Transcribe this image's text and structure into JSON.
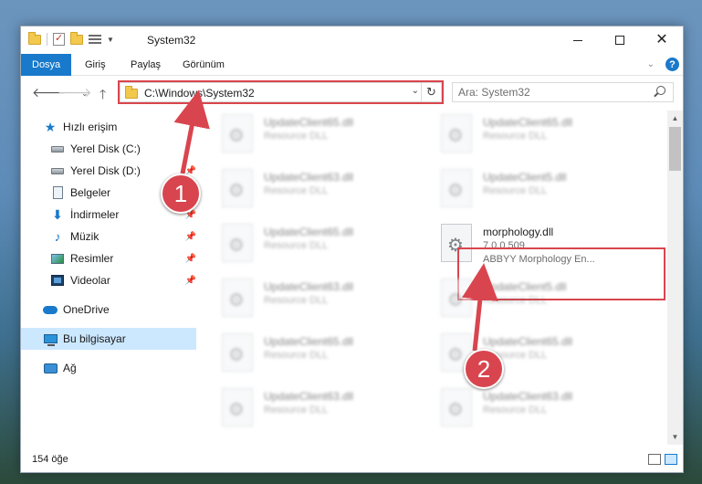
{
  "window": {
    "title": "System32"
  },
  "ribbon": {
    "tabs": [
      "Dosya",
      "Giriş",
      "Paylaş",
      "Görünüm"
    ],
    "help_label": "?"
  },
  "nav": {
    "back_icon": "arrow-left-icon",
    "forward_icon": "arrow-right-icon",
    "recent_icon": "chevron-down-icon",
    "up_icon": "arrow-up-icon"
  },
  "address": {
    "path": "C:\\Windows\\System32"
  },
  "search": {
    "placeholder": "Ara: System32"
  },
  "sidebar": {
    "items": [
      {
        "label": "Hızlı erişim",
        "icon": "star-icon"
      },
      {
        "label": "Yerel Disk (C:)",
        "icon": "drive-icon"
      },
      {
        "label": "Yerel Disk (D:)",
        "icon": "drive-icon"
      },
      {
        "label": "Belgeler",
        "icon": "documents-icon"
      },
      {
        "label": "İndirmeler",
        "icon": "download-icon"
      },
      {
        "label": "Müzik",
        "icon": "music-icon"
      },
      {
        "label": "Resimler",
        "icon": "pictures-icon"
      },
      {
        "label": "Videolar",
        "icon": "videos-icon"
      },
      {
        "label": "OneDrive",
        "icon": "cloud-icon"
      },
      {
        "label": "Bu bilgisayar",
        "icon": "computer-icon"
      },
      {
        "label": "Ağ",
        "icon": "network-icon"
      }
    ]
  },
  "files": {
    "left_column": [
      {
        "name": "UpdateClient65.dll",
        "desc": "Resource DLL"
      },
      {
        "name": "UpdateClient63.dll",
        "desc": "Resource DLL"
      },
      {
        "name": "UpdateClient65.dll",
        "desc": "Resource DLL"
      },
      {
        "name": "UpdateClient63.dll",
        "desc": "Resource DLL"
      },
      {
        "name": "UpdateClient65.dll",
        "desc": "Resource DLL"
      },
      {
        "name": "UpdateClient63.dll",
        "desc": "Resource DLL"
      }
    ],
    "right_column": [
      {
        "name": "UpdateClient65.dll",
        "desc": "Resource DLL"
      },
      {
        "name": "UpdateClient5.dll",
        "desc": "Resource DLL"
      },
      {
        "name": "UpdateClient5.dll",
        "desc": "Resource DLL"
      },
      {
        "name": "UpdateClient65.dll",
        "desc": "Resource DLL"
      },
      {
        "name": "UpdateClient63.dll",
        "desc": "Resource DLL"
      }
    ],
    "highlighted": {
      "name": "morphology.dll",
      "version": "7.0.0.509",
      "desc": "ABBYY Morphology En..."
    }
  },
  "status": {
    "count": "154 öğe"
  },
  "callouts": {
    "one": "1",
    "two": "2",
    "color": "#d9454e"
  }
}
